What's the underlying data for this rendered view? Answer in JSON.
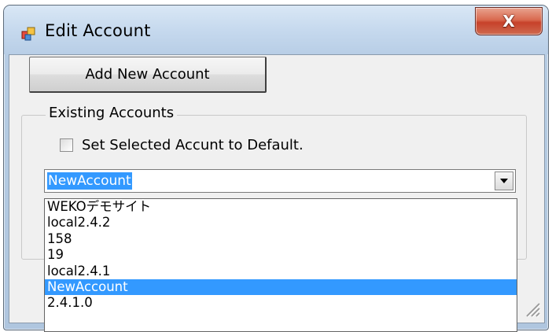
{
  "window": {
    "title": "Edit Account",
    "close_glyph": "X"
  },
  "add_button": {
    "label": "Add New Account"
  },
  "group": {
    "legend": "Existing Accounts",
    "checkbox_label": "Set Selected Accunt to Default.",
    "checkbox_checked": false
  },
  "combo": {
    "selected": "NewAccount"
  },
  "dropdown": {
    "items": [
      "WEKOデモサイト",
      "local2.4.2",
      "158",
      "19",
      "local2.4.1",
      "NewAccount",
      "2.4.1.0"
    ],
    "selected_index": 5
  },
  "colors": {
    "selection": "#3399ff",
    "close_button": "#c7412a"
  },
  "icons": {
    "app": "app-window-icon",
    "close": "close-icon",
    "dropdown": "chevron-down-icon",
    "resize": "resize-grip-icon"
  }
}
